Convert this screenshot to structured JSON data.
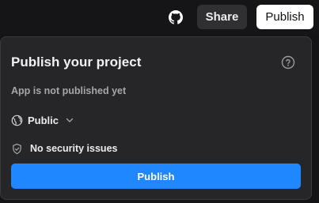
{
  "topbar": {
    "github_icon": "github-icon",
    "share_label": "Share",
    "publish_label": "Publish"
  },
  "panel": {
    "title": "Publish your project",
    "help_icon": "question-circle-icon",
    "status": "App is not published yet",
    "visibility": {
      "icon": "globe-icon",
      "selected": "Public",
      "chevron_icon": "chevron-down-icon"
    },
    "security": {
      "icon": "shield-check-icon",
      "text": "No security issues"
    },
    "publish_button_label": "Publish"
  },
  "colors": {
    "accent": "#1f87ff",
    "panel_bg": "#262629",
    "page_bg": "#141416"
  }
}
